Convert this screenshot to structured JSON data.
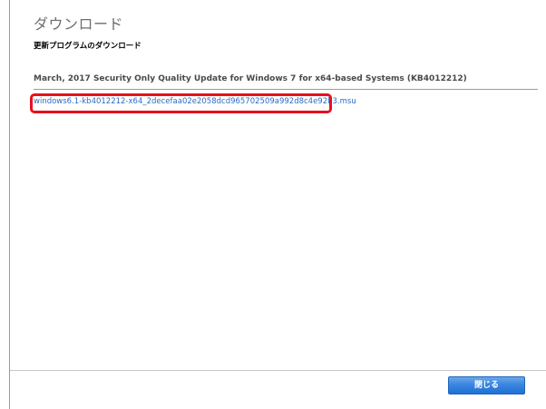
{
  "dialog": {
    "title": "ダウンロード",
    "section_heading": "更新プログラムのダウンロード",
    "update_title": "March, 2017 Security Only Quality Update for Windows 7 for x64-based Systems (KB4012212)",
    "download_link": "windows6.1-kb4012212-x64_2decefaa02e2058dcd965702509a992d8c4e92b3.msu",
    "close_label": "閉じる"
  },
  "colors": {
    "link": "#2a6cc4",
    "highlight": "#e8101e",
    "button": "#2e7edc"
  }
}
